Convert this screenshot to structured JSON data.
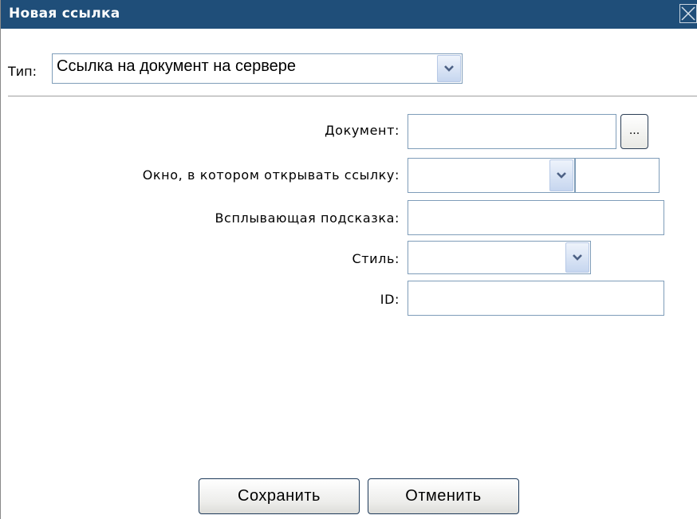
{
  "dialog": {
    "title": "Новая ссылка",
    "close_icon": "close-icon"
  },
  "type": {
    "label": "Тип:",
    "selected": "Ссылка на документ на сервере"
  },
  "form": {
    "document_label": "Документ:",
    "document_value": "",
    "browse_label": "...",
    "target_label": "Окно, в котором открывать ссылку:",
    "target_selected": "",
    "target_text": "",
    "tooltip_label": "Всплывающая подсказка:",
    "tooltip_value": "",
    "style_label": "Стиль:",
    "style_selected": "",
    "id_label": "ID:",
    "id_value": ""
  },
  "buttons": {
    "save": "Сохранить",
    "cancel": "Отменить"
  },
  "colors": {
    "titlebar": "#1f4e79",
    "input_border": "#7f9db9"
  }
}
